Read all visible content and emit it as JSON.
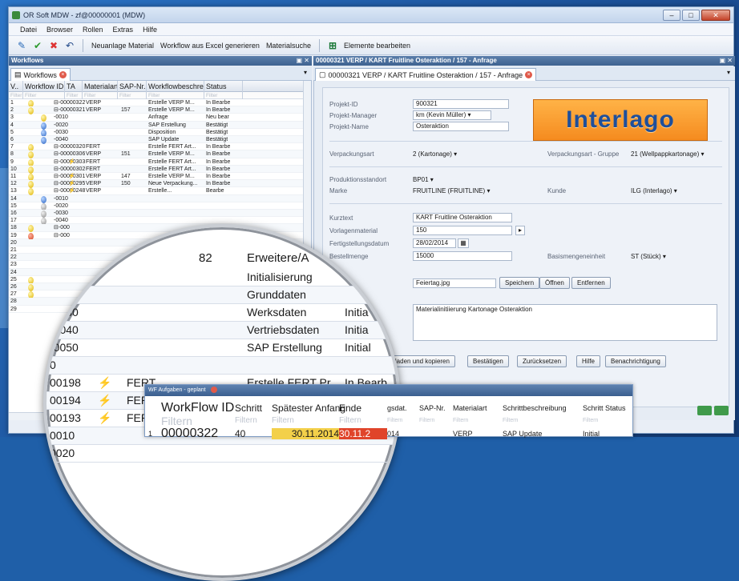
{
  "window": {
    "title": "OR Soft MDW - zf@00000001 (MDW)"
  },
  "menu": [
    "Datei",
    "Browser",
    "Rollen",
    "Extras",
    "Hilfe"
  ],
  "toolbar": {
    "items": [
      "Neuanlage Material",
      "Workflow aus Excel generieren",
      "Materialsuche"
    ],
    "edit_label": "Elemente bearbeiten"
  },
  "left_pane": {
    "title": "Workflows",
    "tab": "Workflows",
    "columns": [
      "V..",
      "Workflow ID",
      "TA",
      "Materialart",
      "SAP-Nr.",
      "Workflowbeschrei..",
      "Status"
    ],
    "filter_label": "Filter",
    "rows": [
      {
        "n": "1",
        "v": "y",
        "id": "⊟-00000322",
        "ta": "",
        "mat": "VERP",
        "sap": "",
        "desc": "Erstelle VERP M...",
        "st": "In Bearbe"
      },
      {
        "n": "2",
        "v": "y",
        "id": "⊟-00000321",
        "ta": "",
        "mat": "VERP",
        "sap": "157",
        "desc": "Erstelle VERP M...",
        "st": "In Bearbe"
      },
      {
        "n": "3",
        "v": "y",
        "id": "  -0010",
        "ta": "",
        "mat": "",
        "sap": "",
        "desc": "Anfrage",
        "st": "Neu bear"
      },
      {
        "n": "4",
        "v": "b",
        "id": "  -0020",
        "ta": "",
        "mat": "",
        "sap": "",
        "desc": "SAP Erstellung",
        "st": "Bestätigt"
      },
      {
        "n": "5",
        "v": "b",
        "id": "  -0030",
        "ta": "",
        "mat": "",
        "sap": "",
        "desc": "Disposition",
        "st": "Bestätigt"
      },
      {
        "n": "6",
        "v": "b",
        "id": "  -0040",
        "ta": "",
        "mat": "",
        "sap": "",
        "desc": "SAP Update",
        "st": "Bestätigt"
      },
      {
        "n": "7",
        "v": "y",
        "id": "⊟-00000320",
        "ta": "",
        "mat": "FERT",
        "sap": "",
        "desc": "Erstelle FERT Art...",
        "st": "In Bearbe"
      },
      {
        "n": "8",
        "v": "y",
        "id": "⊟-00000306",
        "ta": "",
        "mat": "VERP",
        "sap": "151",
        "desc": "Erstelle VERP M...",
        "st": "In Bearbe"
      },
      {
        "n": "9",
        "v": "y",
        "id": "⊟-00000303",
        "ta": "⚡",
        "mat": "FERT",
        "sap": "",
        "desc": "Erstelle FERT Art...",
        "st": "In Bearbe"
      },
      {
        "n": "10",
        "v": "y",
        "id": "⊟-00000302",
        "ta": "",
        "mat": "FERT",
        "sap": "",
        "desc": "Erstelle FERT Art...",
        "st": "In Bearbe"
      },
      {
        "n": "11",
        "v": "y",
        "id": "⊟-00000301",
        "ta": "⚡",
        "mat": "VERP",
        "sap": "147",
        "desc": "Erstelle VERP M...",
        "st": "In Bearbe"
      },
      {
        "n": "12",
        "v": "y",
        "id": "⊟-00000295",
        "ta": "⚡",
        "mat": "VERP",
        "sap": "150",
        "desc": "Neue Verpackung...",
        "st": "In Bearbe"
      },
      {
        "n": "13",
        "v": "y",
        "id": "⊟-00000248",
        "ta": "⚡",
        "mat": "VERP",
        "sap": "",
        "desc": "Erstelle...",
        "st": "Bearbe"
      },
      {
        "n": "14",
        "v": "b",
        "id": "  -0010",
        "ta": "",
        "mat": "",
        "sap": "",
        "desc": "",
        "st": ""
      },
      {
        "n": "15",
        "v": "g",
        "id": "  -0020",
        "ta": "",
        "mat": "",
        "sap": "",
        "desc": "",
        "st": ""
      },
      {
        "n": "16",
        "v": "g",
        "id": "  -0030",
        "ta": "",
        "mat": "",
        "sap": "",
        "desc": "",
        "st": ""
      },
      {
        "n": "17",
        "v": "g",
        "id": "  -0040",
        "ta": "",
        "mat": "",
        "sap": "",
        "desc": "",
        "st": ""
      },
      {
        "n": "18",
        "v": "y",
        "id": "⊟-000",
        "ta": "",
        "mat": "",
        "sap": "",
        "desc": "",
        "st": ""
      },
      {
        "n": "19",
        "v": "r",
        "id": "⊟-000",
        "ta": "",
        "mat": "",
        "sap": "",
        "desc": "",
        "st": ""
      },
      {
        "n": "20",
        "v": "",
        "id": "",
        "ta": "",
        "mat": "",
        "sap": "",
        "desc": "",
        "st": ""
      },
      {
        "n": "21",
        "v": "",
        "id": "",
        "ta": "",
        "mat": "",
        "sap": "",
        "desc": "",
        "st": ""
      },
      {
        "n": "22",
        "v": "",
        "id": "",
        "ta": "",
        "mat": "",
        "sap": "",
        "desc": "",
        "st": ""
      },
      {
        "n": "23",
        "v": "",
        "id": "",
        "ta": "",
        "mat": "",
        "sap": "",
        "desc": "",
        "st": ""
      },
      {
        "n": "24",
        "v": "",
        "id": "",
        "ta": "",
        "mat": "",
        "sap": "",
        "desc": "",
        "st": ""
      },
      {
        "n": "25",
        "v": "y",
        "id": "",
        "ta": "",
        "mat": "",
        "sap": "",
        "desc": "",
        "st": ""
      },
      {
        "n": "26",
        "v": "y",
        "id": "",
        "ta": "",
        "mat": "",
        "sap": "",
        "desc": "",
        "st": ""
      },
      {
        "n": "27",
        "v": "y",
        "id": "",
        "ta": "",
        "mat": "",
        "sap": "",
        "desc": "",
        "st": ""
      },
      {
        "n": "28",
        "v": "",
        "id": "",
        "ta": "",
        "mat": "",
        "sap": "",
        "desc": "",
        "st": ""
      },
      {
        "n": "29",
        "v": "",
        "id": "",
        "ta": "",
        "mat": "",
        "sap": "",
        "desc": "",
        "st": ""
      }
    ]
  },
  "right_pane": {
    "title": "00000321 VERP / KART Fruitline Osteraktion / 157 - Anfrage",
    "tab": "00000321 VERP / KART Fruitline Osteraktion / 157 - Anfrage",
    "logo": "Interlago",
    "fields": {
      "projekt_id_label": "Projekt-ID",
      "projekt_id": "900321",
      "manager_label": "Projekt-Manager",
      "manager": "km (Kevin Müller)",
      "name_label": "Projekt-Name",
      "name": "Osteraktion",
      "verpackungsart_label": "Verpackungsart",
      "verpackungsart": "2 (Kartonage)",
      "gruppe_label": "Verpackungsart - Gruppe",
      "gruppe": "21 (Wellpappkartonage)",
      "standort_label": "Produktionsstandort",
      "standort": "BP01",
      "marke_label": "Marke",
      "marke": "FRUITLINE (FRUITLINE)",
      "kunde_label": "Kunde",
      "kunde": "ILG (Interlago)",
      "kurztext_label": "Kurztext",
      "kurztext": "KART Fruitline Osteraktion",
      "vorlage_label": "Vorlagenmaterial",
      "vorlage": "150",
      "datum_label": "Fertigstellungsdatum",
      "datum": "28/02/2014",
      "menge_label": "Bestellmenge",
      "menge": "15000",
      "basis_label": "Basismengeneinheit",
      "basis": "ST (Stück)",
      "datei": "Feiertag.jpg",
      "notiz": "Materialinitiierung Kartonage Osteraktion"
    },
    "file_buttons": [
      "Speichern",
      "Öffnen",
      "Entfernen"
    ],
    "action_buttons": [
      "ekt laden und kopieren",
      "Bestätigen",
      "Zurücksetzen",
      "Hilfe",
      "Benachrichtigung"
    ]
  },
  "magnifier": {
    "top_values": {
      "sap": "82",
      "desc": "Erweitere/A"
    },
    "rows": [
      {
        "id": "-0010",
        "ta": "",
        "mat": "",
        "desc": "Initialisierung",
        "st": ""
      },
      {
        "id": "-0020",
        "ta": "",
        "mat": "",
        "desc": "Grunddaten",
        "st": ""
      },
      {
        "id": "-0030",
        "ta": "",
        "mat": "",
        "desc": "Werksdaten",
        "st": "Initia"
      },
      {
        "id": "-0040",
        "ta": "",
        "mat": "",
        "desc": "Vertriebsdaten",
        "st": "Initia"
      },
      {
        "id": "-0050",
        "ta": "",
        "mat": "",
        "desc": "SAP Erstellung",
        "st": "Initial"
      },
      {
        "id": "0",
        "ta": "",
        "mat": "",
        "desc": "",
        "st": ""
      },
      {
        "id": "00198",
        "ta": "⚡",
        "mat": "FERT",
        "desc": "Erstelle FERT Pr...",
        "st": "In Bearb"
      },
      {
        "id": "00194",
        "ta": "⚡",
        "mat": "FERT",
        "desc": "Erstelle FERT Pr...",
        "st": "In Bearbe"
      },
      {
        "id": "00193",
        "ta": "⚡",
        "mat": "FERT",
        "desc": "Erstelle FERT Pr...",
        "st": "In Bearbe"
      },
      {
        "id": "0010",
        "ta": "",
        "mat": "",
        "desc": "",
        "st": ""
      },
      {
        "id": "0020",
        "ta": "",
        "mat": "",
        "desc": "",
        "st": ""
      }
    ]
  },
  "subwindow": {
    "title": "WF Aufgaben - geplant",
    "columns": [
      "WorkFlow ID",
      "Schritt",
      "Spätester Anfang",
      "Ende",
      "gsdat.",
      "SAP-Nr.",
      "Materialart",
      "Schrittbeschreibung",
      "Schritt Status"
    ],
    "filter_label": "Filtern",
    "row": {
      "n": "1",
      "id": "00000322",
      "schritt": "40",
      "anfang": "30.11.2014",
      "ende": "30.11.2",
      "gsdat": "014",
      "sap": "",
      "mat": "VERP",
      "desc": "SAP Update",
      "st": "Initial"
    }
  },
  "colors": {
    "accent": "#3e6290",
    "logo_bg": "#f58b1f",
    "logo_text": "#1f4f9a"
  }
}
